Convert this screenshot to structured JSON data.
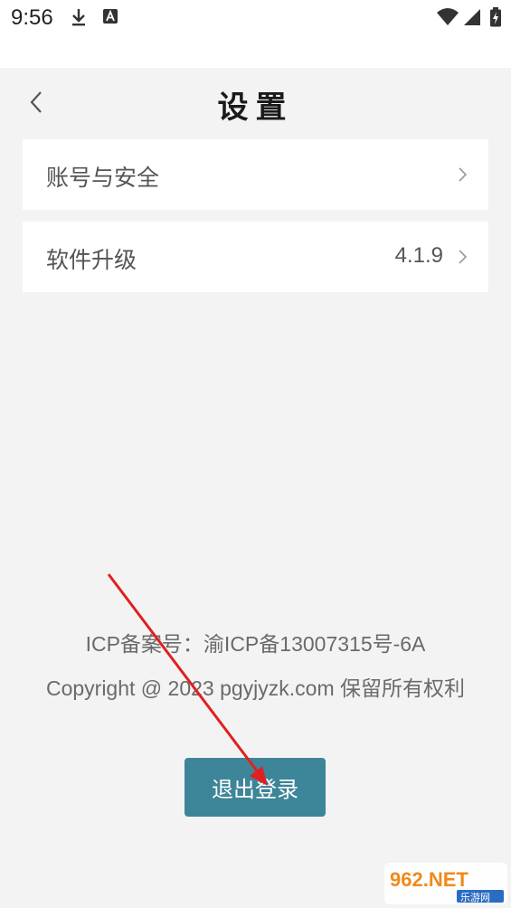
{
  "status_bar": {
    "time": "9:56",
    "icons": [
      "download-icon",
      "a-badge-icon",
      "wifi-icon",
      "signal-icon",
      "battery-charging-icon"
    ]
  },
  "header": {
    "title": "设置",
    "back_icon": "chevron-left-icon"
  },
  "settings": {
    "items": [
      {
        "label": "账号与安全",
        "value": ""
      },
      {
        "label": "软件升级",
        "value": "4.1.9"
      }
    ]
  },
  "footer": {
    "icp": "ICP备案号：渝ICP备13007315号-6A",
    "copyright": "Copyright @ 2023 pgyjyzk.com 保留所有权利"
  },
  "logout": {
    "label": "退出登录",
    "color": "#3d8599"
  },
  "watermark": {
    "brand": "962.NET",
    "sub": "乐游网"
  },
  "annotation": {
    "arrow_color": "#e02020"
  }
}
